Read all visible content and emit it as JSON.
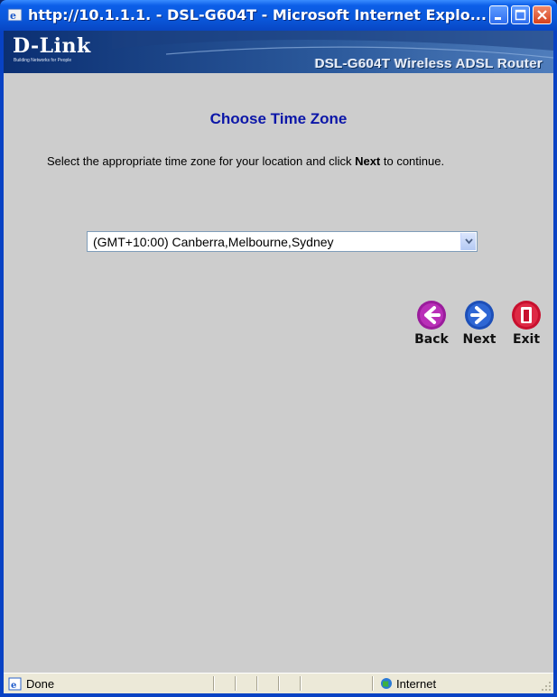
{
  "window": {
    "title": "http://10.1.1.1. - DSL-G604T - Microsoft Internet Explo...",
    "controls": [
      "minimize",
      "maximize",
      "close"
    ]
  },
  "banner": {
    "logo": "D-Link",
    "tagline": "Building Networks for People",
    "model": "DSL-G604T Wireless ADSL Router"
  },
  "page": {
    "heading": "Choose Time Zone",
    "intro_before": "Select the appropriate time zone for your location and click ",
    "intro_bold": "Next",
    "intro_after": " to continue.",
    "timezone_selected": "(GMT+10:00) Canberra,Melbourne,Sydney"
  },
  "nav": {
    "back_label": "Back",
    "next_label": "Next",
    "exit_label": "Exit"
  },
  "status": {
    "text": "Done",
    "zone": "Internet"
  },
  "colors": {
    "heading": "#0b16a8",
    "content_bg": "#cdcdcd",
    "back_button": "#9a1c9c",
    "next_button": "#1d4fb8",
    "exit_button": "#c8102e"
  }
}
